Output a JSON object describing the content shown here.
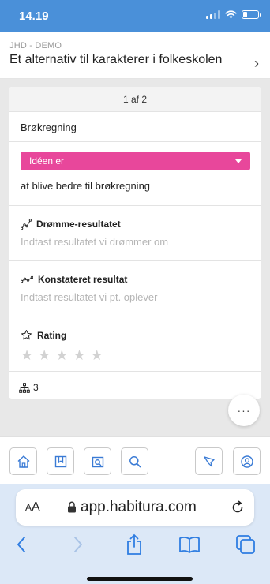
{
  "status_bar": {
    "time": "14.19"
  },
  "header": {
    "subtitle": "JHD - DEMO",
    "title": "Et alternativ til karakterer i folkeskolen",
    "chevron": "›"
  },
  "card": {
    "pager": "1 af 2",
    "title": "Brøkregning",
    "idea": {
      "dropdown_label": "Idéen er",
      "text": "at blive bedre til brøkregning",
      "color": "#e8479b"
    },
    "dream_result": {
      "label": "Drømme-resultatet",
      "placeholder": "Indtast resultatet vi drømmer om"
    },
    "observed_result": {
      "label": "Konstateret resultat",
      "placeholder": "Indtast resultatet vi pt. oplever"
    },
    "rating": {
      "label": "Rating",
      "stars": [
        "★",
        "★",
        "★",
        "★",
        "★"
      ],
      "value": 0,
      "max": 5
    },
    "footer": {
      "count": "3",
      "icon": "hierarchy-icon"
    }
  },
  "fab": {
    "label": "···"
  },
  "toolbar": {
    "buttons": [
      "home-icon",
      "bookmark-icon",
      "photo-icon",
      "search-icon",
      "flag-icon",
      "user-icon"
    ]
  },
  "browser": {
    "aa_small": "A",
    "aa_large": "A",
    "url": "app.habitura.com"
  },
  "colors": {
    "status_bar": "#4a90d9",
    "accent_pink": "#e8479b",
    "toolbar_icon": "#3a7bd5"
  }
}
